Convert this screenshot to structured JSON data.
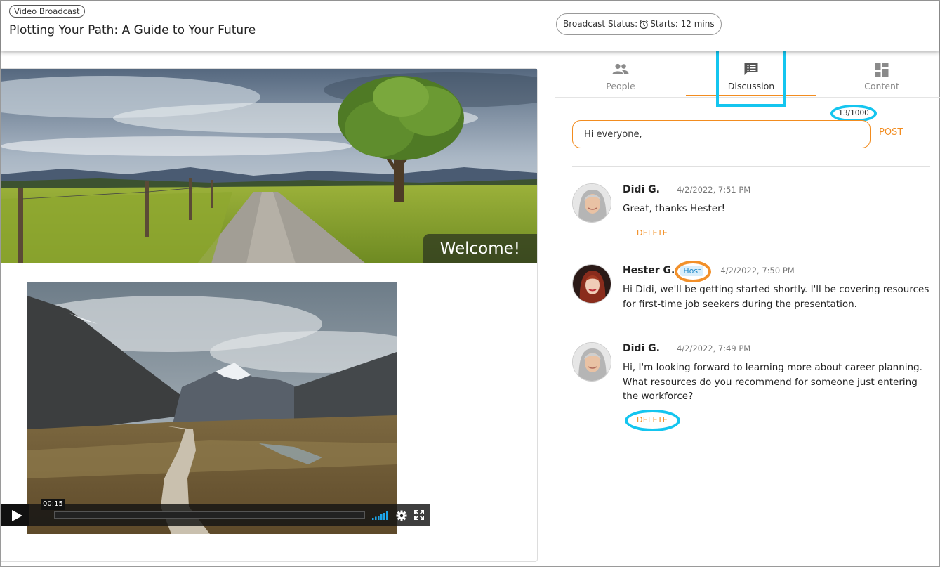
{
  "header": {
    "badge": "Video Broadcast",
    "title": "Plotting Your Path: A Guide to Your Future",
    "status_label": "Broadcast Status:",
    "status_value": "Starts: 12 mins"
  },
  "content": {
    "banner_caption": "Welcome!",
    "video": {
      "time": "00:15",
      "progress": 0.0
    }
  },
  "sidebar": {
    "tabs": [
      {
        "label": "People",
        "icon": "people-icon"
      },
      {
        "label": "Discussion",
        "icon": "discussion-icon",
        "active": true
      },
      {
        "label": "Content",
        "icon": "content-icon"
      }
    ],
    "char_counter": "13/1000",
    "composer_value": "Hi everyone,",
    "post_label": "POST",
    "messages": [
      {
        "author": "Didi G.",
        "timestamp": "4/2/2022, 7:51 PM",
        "body": "Great, thanks Hester!",
        "delete_label": "DELETE"
      },
      {
        "author": "Hester G.",
        "badge": "Host",
        "timestamp": "4/2/2022, 7:50 PM",
        "body": "Hi Didi, we'll be getting started shortly. I'll be covering resources for first-time job seekers during the presentation."
      },
      {
        "author": "Didi G.",
        "timestamp": "4/2/2022, 7:49 PM",
        "body": "Hi, I'm looking forward to learning more about career planning. What resources do you recommend for someone just entering the workforce?",
        "delete_label": "DELETE"
      }
    ]
  },
  "colors": {
    "accent": "#f28c1f",
    "highlight": "#14c5ef",
    "host_badge": "#1e88c8"
  }
}
